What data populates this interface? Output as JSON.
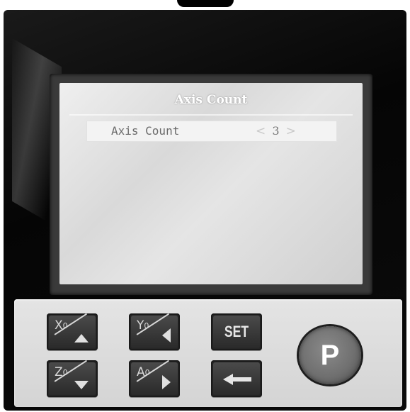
{
  "screen": {
    "title": "Axis Count",
    "menu_item": {
      "label": "Axis Count",
      "value": "3",
      "left_chevron": "<",
      "right_chevron": ">"
    }
  },
  "keypad": {
    "x_key": {
      "axis": "X",
      "sub": "0",
      "icon": "arrow-up-icon"
    },
    "y_key": {
      "axis": "Y",
      "sub": "0",
      "icon": "arrow-left-icon"
    },
    "set_key": {
      "label": "SET"
    },
    "z_key": {
      "axis": "Z",
      "sub": "0",
      "icon": "arrow-down-icon"
    },
    "a_key": {
      "axis": "A",
      "sub": "0",
      "icon": "arrow-right-icon"
    },
    "back_key": {
      "icon": "back-arrow-icon"
    },
    "p_key": {
      "label": "P"
    }
  },
  "colors": {
    "lcd_background": "#dcdcdc",
    "key_face": "#2a2a2a",
    "p_button": "#707070"
  }
}
